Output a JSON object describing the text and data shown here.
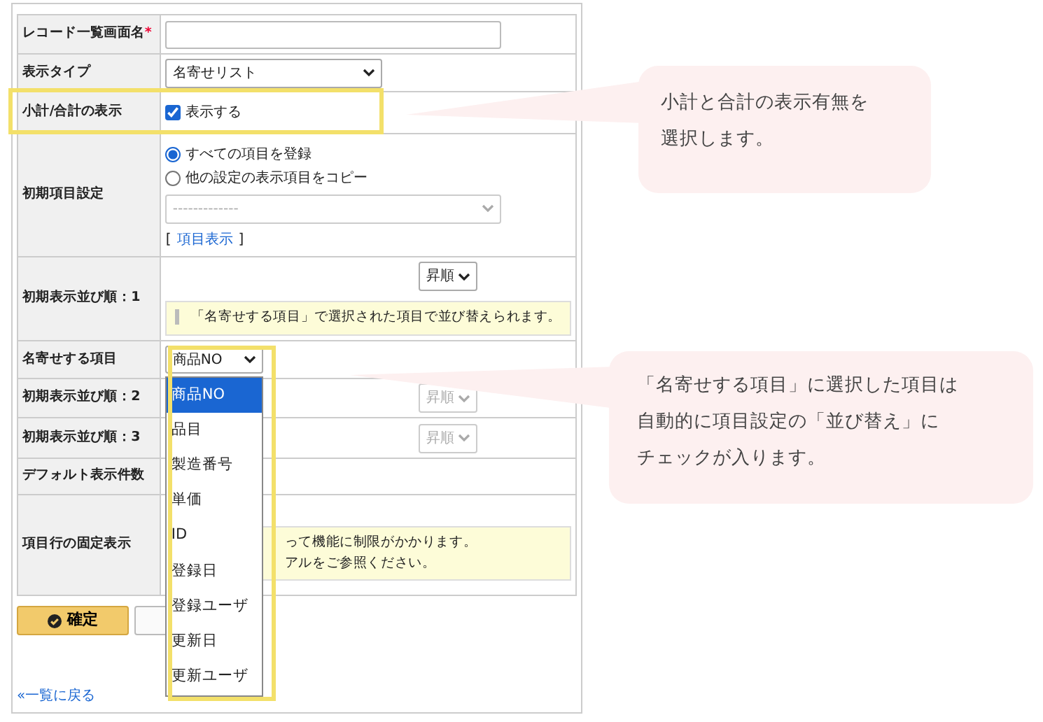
{
  "form": {
    "rows": [
      {
        "kind": "text",
        "label": "レコード一覧画面名",
        "required_mark": "*"
      },
      {
        "kind": "select",
        "label": "表示タイプ",
        "value": "名寄せリスト"
      },
      {
        "kind": "checkbox",
        "label": "小計/合計の表示",
        "option": "表示する",
        "checked": true,
        "highlighted": true
      },
      {
        "kind": "radios",
        "label": "初期項目設定",
        "options": [
          {
            "label": "すべての項目を登録",
            "selected": true
          },
          {
            "label": "他の設定の表示項目をコピー",
            "selected": false
          }
        ],
        "copy_select": {
          "placeholder": "-------------",
          "disabled": true
        },
        "link_open": "[",
        "link": "項目表示",
        "link_close": "]"
      },
      {
        "kind": "sort",
        "label": "初期表示並び順：1",
        "order": "昇順",
        "disabled": false,
        "note": "「名寄せする項目」で選択された項目で並び替えられます。"
      },
      {
        "kind": "dropdown",
        "label": "名寄せする項目",
        "value": "商品NO",
        "highlighted": true,
        "options": [
          {
            "label": "商品NO",
            "selected": true
          },
          {
            "label": "品目",
            "selected": false
          },
          {
            "label": "製造番号",
            "selected": false
          },
          {
            "label": "単価",
            "selected": false
          },
          {
            "label": "ID",
            "selected": false
          },
          {
            "label": "登録日",
            "selected": false
          },
          {
            "label": "登録ユーザ",
            "selected": false
          },
          {
            "label": "更新日",
            "selected": false
          },
          {
            "label": "更新ユーザ",
            "selected": false
          }
        ]
      },
      {
        "kind": "sort",
        "label": "初期表示並び順：2",
        "order": "昇順",
        "disabled": true
      },
      {
        "kind": "sort",
        "label": "初期表示並び順：3",
        "order": "昇順",
        "disabled": true
      },
      {
        "kind": "blank",
        "label": "デフォルト表示件数"
      },
      {
        "kind": "note",
        "label": "項目行の固定表示",
        "note_lines": [
          "って機能に制限がかかります。",
          "アルをご参照ください。"
        ]
      }
    ]
  },
  "buttons": [
    {
      "kind": "primary",
      "label": "確定"
    },
    {
      "kind": "secondary"
    }
  ],
  "back_link": "«一覧に戻る",
  "callouts": [
    {
      "lines": [
        "小計と合計の表示有無を",
        "選択します。"
      ]
    },
    {
      "lines": [
        "「名寄せする項目」に選択した項目は",
        "自動的に項目設定の「並び替え」に",
        "チェックが入ります。"
      ]
    }
  ]
}
